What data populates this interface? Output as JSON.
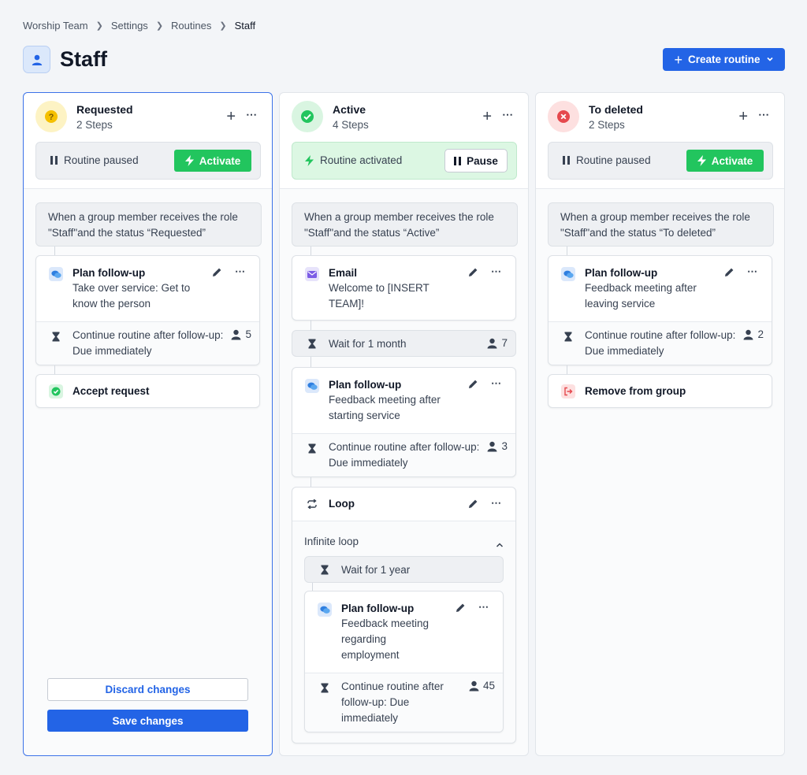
{
  "breadcrumb": [
    "Worship Team",
    "Settings",
    "Routines",
    "Staff"
  ],
  "page": {
    "title": "Staff",
    "create_label": "Create routine"
  },
  "colors": {
    "primary": "#2364e6",
    "success": "#22c55e",
    "warning": "#f5c000",
    "danger": "#e5484d"
  },
  "columns": [
    {
      "title": "Requested",
      "steps": "2 Steps",
      "status": {
        "label": "Routine paused",
        "button": "Activate"
      },
      "trigger": "When a group member receives the role \"Staff\"and the status “Requested”",
      "followup": {
        "title": "Plan follow-up",
        "desc": "Take over service: Get to know the person",
        "continue": "Continue routine after follow-up: Due immediately",
        "count": "5"
      },
      "final": {
        "title": "Accept request"
      },
      "discard_label": "Discard changes",
      "save_label": "Save changes"
    },
    {
      "title": "Active",
      "steps": "4 Steps",
      "status": {
        "label": "Routine activated",
        "button": "Pause"
      },
      "trigger": "When a group member receives the role \"Staff\"and the status “Active”",
      "email": {
        "title": "Email",
        "desc": "Welcome to [INSERT TEAM]!"
      },
      "wait1": {
        "label": "Wait for 1 month",
        "count": "7"
      },
      "followup": {
        "title": "Plan follow-up",
        "desc": "Feedback meeting after starting service",
        "continue": "Continue routine after follow-up: Due immediately",
        "count": "3"
      },
      "loop": {
        "title": "Loop",
        "mode": "Infinite loop",
        "wait": "Wait for 1 year",
        "followup": {
          "title": "Plan follow-up",
          "desc": "Feedback meeting regarding employment",
          "continue": "Continue routine after follow-up: Due immediately",
          "count": "45"
        }
      }
    },
    {
      "title": "To deleted",
      "steps": "2 Steps",
      "status": {
        "label": "Routine paused",
        "button": "Activate"
      },
      "trigger": "When a group member receives the role \"Staff\"and the status “To deleted”",
      "followup": {
        "title": "Plan follow-up",
        "desc": "Feedback meeting after leaving service",
        "continue": "Continue routine after follow-up: Due immediately",
        "count": "2"
      },
      "final": {
        "title": "Remove from group"
      }
    }
  ]
}
